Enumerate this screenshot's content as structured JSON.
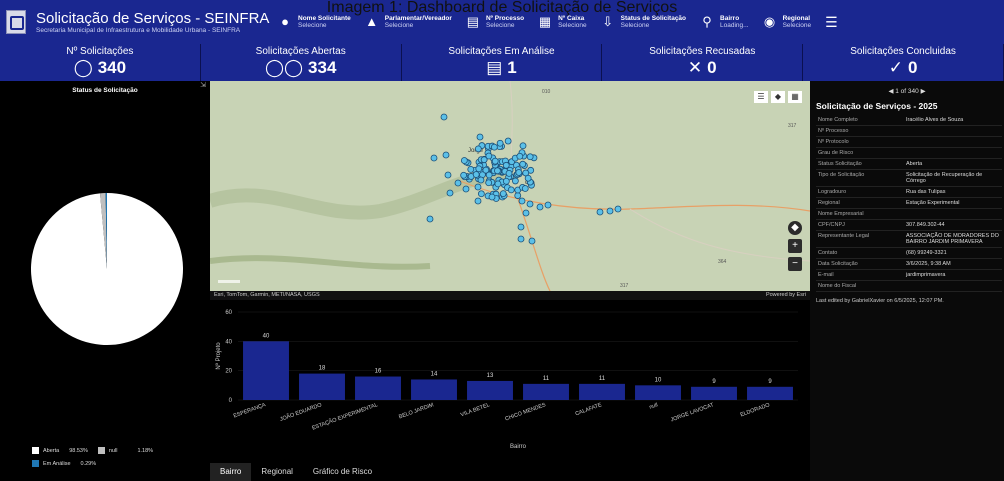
{
  "caption": "Imagem 1: Dashboard de Solicitação de Serviços",
  "header": {
    "title": "Solicitação de Serviços - SEINFRA",
    "subtitle": "Secretaria Municipal de Infraestrutura e Mobilidade Urbana - SEINFRA",
    "filters": [
      {
        "label": "Nome Solicitante",
        "value": "Selecione",
        "icon": "person-icon"
      },
      {
        "label": "Parlamentar/Vereador",
        "value": "Selecione",
        "icon": "speaker-icon"
      },
      {
        "label": "Nº Processo",
        "value": "Selecione",
        "icon": "document-icon"
      },
      {
        "label": "Nº Caixa",
        "value": "Selecione",
        "icon": "box-icon"
      },
      {
        "label": "Status de Solicitação",
        "value": "Selecione",
        "icon": "download-circle-icon"
      },
      {
        "label": "Bairro",
        "value": "Loading...",
        "icon": "location-search-icon"
      },
      {
        "label": "Regional",
        "value": "Selecione",
        "icon": "map-pin-icon"
      }
    ]
  },
  "kpis": [
    {
      "title": "Nº Solicitações",
      "value": "340",
      "icon": "user-icon"
    },
    {
      "title": "Solicitações Abertas",
      "value": "334",
      "icon": "users-icon"
    },
    {
      "title": "Solicitações Em Análise",
      "value": "1",
      "icon": "search-document-icon"
    },
    {
      "title": "Solicitações Recusadas",
      "value": "0",
      "icon": "x-icon"
    },
    {
      "title": "Solicitações Concluidas",
      "value": "0",
      "icon": "check-icon"
    }
  ],
  "status_panel": {
    "title": "Status de Solicitação",
    "legend": [
      {
        "label": "Aberta",
        "pct": "98.53%",
        "color": "#ffffff"
      },
      {
        "label": "null",
        "pct": "1.18%",
        "color": "#bfbfbf"
      },
      {
        "label": "Em Análise",
        "pct": "0.29%",
        "color": "#1f77b4"
      }
    ],
    "slices": [
      98.53,
      1.18,
      0.29
    ]
  },
  "map": {
    "credit": "Esri, TomTom, Garmin, METI/NASA, USGS",
    "powered": "Powered by Esri",
    "road_labels": [
      "010",
      "317",
      "364",
      "317"
    ],
    "town_label": "Jorge",
    "town_label2": "co"
  },
  "chart_data": {
    "type": "bar",
    "categories": [
      "ESPERANÇA",
      "JOÃO EDUARDO",
      "ESTAÇÃO EXPERIMENTAL",
      "BELO JARDIM",
      "VILA BETEL",
      "CHICO MENDES",
      "CALAFATE",
      "null",
      "JORGE LAVOCAT",
      "ELDORADO"
    ],
    "values": [
      40,
      18,
      16,
      14,
      13,
      11,
      11,
      10,
      9,
      9
    ],
    "xlabel": "Bairro",
    "ylabel": "Nº Projeto",
    "yticks": [
      "0",
      "20",
      "40",
      "60"
    ],
    "ylim": [
      0,
      60
    ],
    "color": "#1a2790"
  },
  "tabs": [
    "Bairro",
    "Regional",
    "Gráfico de Risco"
  ],
  "details": {
    "pager": "1 of 340",
    "title": "Solicitação de Serviços - 2025",
    "fields": [
      {
        "k": "Nome Completo",
        "v": "Iracélio Alves de Souza"
      },
      {
        "k": "Nº Processo",
        "v": ""
      },
      {
        "k": "Nº Protocolo",
        "v": ""
      },
      {
        "k": "Grau de Risco",
        "v": ""
      },
      {
        "k": "Status Solicitação",
        "v": "Aberta"
      },
      {
        "k": "Tipo de Solicitação",
        "v": "Solicitação de Recuperação de Córrego"
      },
      {
        "k": "Logradouro",
        "v": "Rua das Tulipas"
      },
      {
        "k": "Regional",
        "v": "Estação Experimental"
      },
      {
        "k": "Nome Empresarial",
        "v": ""
      },
      {
        "k": "CPF/CNPJ",
        "v": "307.849.302-44"
      },
      {
        "k": "Representante Legal",
        "v": "ASSOCIAÇÃO DE MORADORES DO BAIRRO JARDIM PRIMAVERA"
      },
      {
        "k": "Contato",
        "v": "(68) 99249-3321"
      },
      {
        "k": "Data Solicitação",
        "v": "3/6/2025, 9:38 AM"
      },
      {
        "k": "E-mail",
        "v": "jardimprimavera"
      },
      {
        "k": "Nome do Fiscal",
        "v": ""
      }
    ],
    "last_edited": "Last edited by GabrielXavier on 6/5/2025, 12:07 PM."
  }
}
